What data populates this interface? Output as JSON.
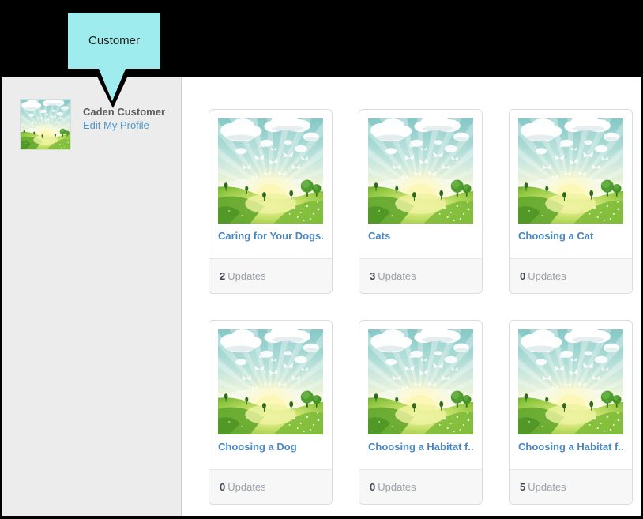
{
  "tooltip": {
    "label": "Customer"
  },
  "sidebar": {
    "profile": {
      "name": "Caden Customer",
      "edit_profile_label": "Edit My Profile"
    }
  },
  "cards": [
    {
      "title": "Caring for Your Dogs...",
      "updates_count": "2",
      "updates_label": "Updates"
    },
    {
      "title": "Cats",
      "updates_count": "3",
      "updates_label": "Updates"
    },
    {
      "title": "Choosing a Cat",
      "updates_count": "0",
      "updates_label": "Updates"
    },
    {
      "title": "Choosing a Dog",
      "updates_count": "0",
      "updates_label": "Updates"
    },
    {
      "title": "Choosing a Habitat f...",
      "updates_count": "0",
      "updates_label": "Updates"
    },
    {
      "title": "Choosing a Habitat f...",
      "updates_count": "5",
      "updates_label": "Updates"
    }
  ],
  "colors": {
    "banner_bg": "#000000",
    "tooltip_fill": "#9fecef",
    "sidebar_bg": "#ececec",
    "link_blue": "#4a86c2",
    "card_footer_bg": "#f7f7f7",
    "count_color": "#3f4650",
    "updates_label_color": "#9aa0a6"
  }
}
